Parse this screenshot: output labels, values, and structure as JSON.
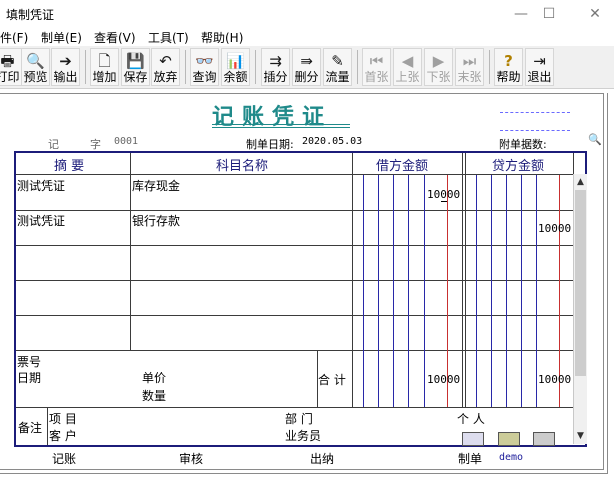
{
  "window": {
    "title": "填制凭证",
    "min": "—",
    "max": "☐",
    "close": "✕"
  },
  "menu": [
    "件(F)",
    "制单(E)",
    "查看(V)",
    "工具(T)",
    "帮助(H)"
  ],
  "toolbar": [
    {
      "label": "打印",
      "icon": "print-icon",
      "glyph": "🖶",
      "enabled": true
    },
    {
      "label": "预览",
      "icon": "preview-icon",
      "glyph": "🔍",
      "enabled": true
    },
    {
      "label": "输出",
      "icon": "output-icon",
      "glyph": "➔",
      "enabled": true
    },
    {
      "label": "增加",
      "icon": "add-icon",
      "glyph": "🗋",
      "enabled": true
    },
    {
      "label": "保存",
      "icon": "save-icon",
      "glyph": "💾",
      "enabled": true
    },
    {
      "label": "放弃",
      "icon": "undo-icon",
      "glyph": "↶",
      "enabled": true
    },
    {
      "label": "查询",
      "icon": "binoculars-icon",
      "glyph": "👓",
      "enabled": true
    },
    {
      "label": "余额",
      "icon": "balance-chart-icon",
      "glyph": "📊",
      "enabled": true
    },
    {
      "label": "插分",
      "icon": "insert-line-icon",
      "glyph": "⇉",
      "enabled": true
    },
    {
      "label": "删分",
      "icon": "delete-line-icon",
      "glyph": "⇛",
      "enabled": true
    },
    {
      "label": "流量",
      "icon": "cashflow-icon",
      "glyph": "✎",
      "enabled": true
    },
    {
      "label": "首张",
      "icon": "first-icon",
      "glyph": "⏮",
      "enabled": false
    },
    {
      "label": "上张",
      "icon": "prev-icon",
      "glyph": "◀",
      "enabled": false
    },
    {
      "label": "下张",
      "icon": "next-icon",
      "glyph": "▶",
      "enabled": false
    },
    {
      "label": "末张",
      "icon": "last-icon",
      "glyph": "⏭",
      "enabled": false
    },
    {
      "label": "帮助",
      "icon": "help-icon",
      "glyph": "?",
      "enabled": true
    },
    {
      "label": "退出",
      "icon": "exit-icon",
      "glyph": "⇥",
      "enabled": true
    }
  ],
  "voucher": {
    "title": "记账凭证",
    "type_label": "记",
    "number_label": "字",
    "number": "0001",
    "date_label": "制单日期:",
    "date": "2020.05.03",
    "attachments_label": "附单据数:",
    "headers": {
      "summary": "摘 要",
      "account": "科目名称",
      "debit": "借方金额",
      "credit": "贷方金额"
    },
    "rows": [
      {
        "summary": "测试凭证",
        "account": "库存现金",
        "debit": "10000",
        "credit": ""
      },
      {
        "summary": "测试凭证",
        "account": "银行存款",
        "debit": "",
        "credit": "10000"
      },
      {
        "summary": "",
        "account": "",
        "debit": "",
        "credit": ""
      },
      {
        "summary": "",
        "account": "",
        "debit": "",
        "credit": ""
      },
      {
        "summary": "",
        "account": "",
        "debit": "",
        "credit": ""
      }
    ],
    "ticket_label": "票号",
    "date_row_label": "日期",
    "unit_price_label": "单价",
    "quantity_label": "数量",
    "total_label": "合 计",
    "total_debit": "10000",
    "total_credit": "10000",
    "remarks_label": "备注",
    "project_label": "项  目",
    "customer_label": "客  户",
    "dept_label": "部  门",
    "person_label": "个  人",
    "salesman_label": "业务员"
  },
  "footer": {
    "bookkeeper_label": "记账",
    "auditor_label": "审核",
    "cashier_label": "出纳",
    "maker_label": "制单",
    "maker": "demo"
  }
}
